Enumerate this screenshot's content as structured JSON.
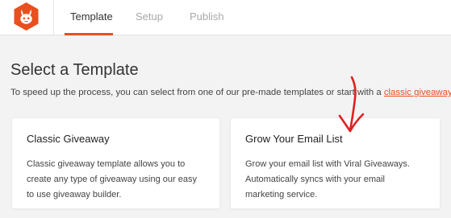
{
  "brand": {
    "logo_icon": "rabbit-logo-icon",
    "accent_color": "#e8501f"
  },
  "tabs": [
    {
      "label": "Template",
      "active": true
    },
    {
      "label": "Setup",
      "active": false
    },
    {
      "label": "Publish",
      "active": false
    }
  ],
  "main": {
    "title": "Select a Template",
    "intro_text": "To speed up the process, you can select from one of our pre-made templates or start with a ",
    "intro_link": "classic giveaway",
    "intro_end": "."
  },
  "cards": [
    {
      "title": "Classic Giveaway",
      "description_lines": [
        "Classic giveaway template allows you to",
        "create any type of giveaway using our easy",
        "to use giveaway builder."
      ]
    },
    {
      "title": "Grow Your Email List",
      "description_lines": [
        "Grow your email list with Viral Giveaways.",
        "Automatically syncs with your email",
        "marketing service."
      ]
    }
  ],
  "annotation": {
    "arrow_icon": "hand-drawn-arrow-icon",
    "arrow_color": "#e02020"
  }
}
